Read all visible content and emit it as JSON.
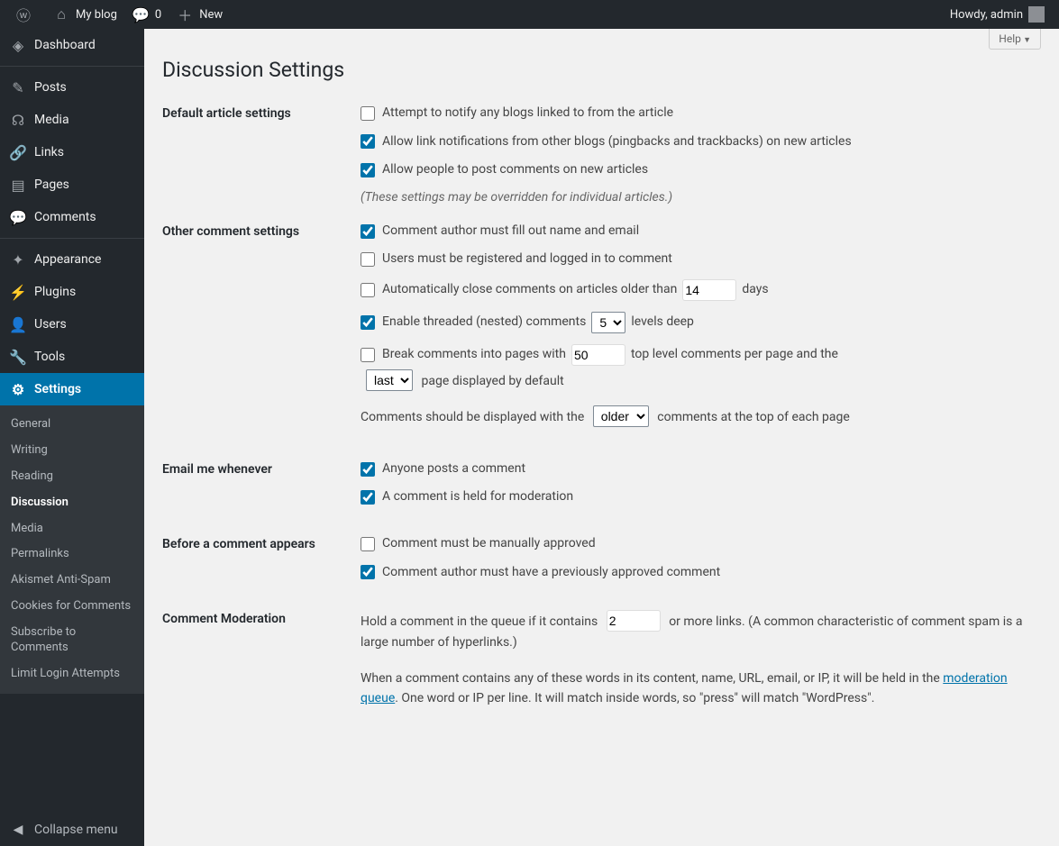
{
  "adminbar": {
    "site_name": "My blog",
    "comments_count": "0",
    "new_label": "New",
    "howdy": "Howdy, admin"
  },
  "sidebar": {
    "dashboard": "Dashboard",
    "posts": "Posts",
    "media": "Media",
    "links": "Links",
    "pages": "Pages",
    "comments": "Comments",
    "appearance": "Appearance",
    "plugins": "Plugins",
    "users": "Users",
    "tools": "Tools",
    "settings": "Settings",
    "collapse": "Collapse menu",
    "sub": {
      "general": "General",
      "writing": "Writing",
      "reading": "Reading",
      "discussion": "Discussion",
      "media": "Media",
      "permalinks": "Permalinks",
      "akismet": "Akismet Anti-Spam",
      "cookies": "Cookies for Comments",
      "subscribe": "Subscribe to Comments",
      "limitlogin": "Limit Login Attempts"
    }
  },
  "page": {
    "help": "Help",
    "title": "Discussion Settings",
    "sections": {
      "default_article": {
        "heading": "Default article settings",
        "notify": "Attempt to notify any blogs linked to from the article",
        "pingback": "Allow link notifications from other blogs (pingbacks and trackbacks) on new articles",
        "allow_comments": "Allow people to post comments on new articles",
        "note": "(These settings may be overridden for individual articles.)"
      },
      "other": {
        "heading": "Other comment settings",
        "require_name": "Comment author must fill out name and email",
        "require_reg": "Users must be registered and logged in to comment",
        "auto_close_pre": "Automatically close comments on articles older than",
        "auto_close_days": "14",
        "auto_close_post": "days",
        "threaded_pre": "Enable threaded (nested) comments",
        "threaded_levels": "5",
        "threaded_post": "levels deep",
        "break_pre": "Break comments into pages with",
        "break_count": "50",
        "break_mid": "top level comments per page and the",
        "break_page": "last",
        "break_post": "page displayed by default",
        "order_pre": "Comments should be displayed with the",
        "order_val": "older",
        "order_post": "comments at the top of each page"
      },
      "email": {
        "heading": "Email me whenever",
        "anyone": "Anyone posts a comment",
        "held": "A comment is held for moderation"
      },
      "before": {
        "heading": "Before a comment appears",
        "manual": "Comment must be manually approved",
        "prev_approved": "Comment author must have a previously approved comment"
      },
      "moderation": {
        "heading": "Comment Moderation",
        "hold_pre": "Hold a comment in the queue if it contains",
        "hold_count": "2",
        "hold_post": "or more links. (A common characteristic of comment spam is a large number of hyperlinks.)",
        "words_pre": "When a comment contains any of these words in its content, name, URL, email, or IP, it will be held in the ",
        "words_link": "moderation queue",
        "words_post": ". One word or IP per line. It will match inside words, so \"press\" will match \"WordPress\"."
      }
    }
  }
}
